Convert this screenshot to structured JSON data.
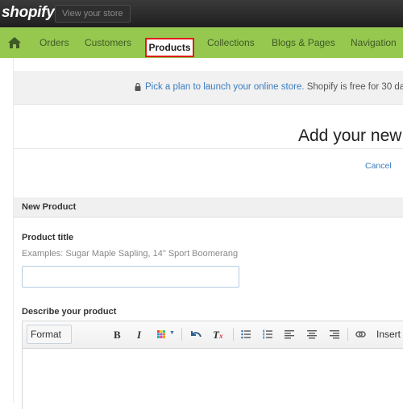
{
  "topbar": {
    "logo": "shopify",
    "view_store_label": "View your store"
  },
  "nav": {
    "items": [
      {
        "label": "Orders"
      },
      {
        "label": "Customers"
      },
      {
        "label": "Products",
        "active": true
      },
      {
        "label": "Collections"
      },
      {
        "label": "Blogs & Pages"
      },
      {
        "label": "Navigation"
      }
    ]
  },
  "banner": {
    "link_text": "Pick a plan to launch your online store.",
    "text": " Shopify is free for 30 da"
  },
  "page": {
    "title": "Add your new",
    "cancel_label": "Cancel"
  },
  "form": {
    "section_title": "New Product",
    "product_title_label": "Product title",
    "product_title_hint": "Examples: Sugar Maple Sapling, 14\" Sport Boomerang",
    "product_title_value": "",
    "describe_label": "Describe your product",
    "toolbar": {
      "format_label": "Format",
      "bold_label": "B",
      "italic_label": "I",
      "insert_label": "Insert"
    }
  },
  "colors": {
    "nav_green": "#96c850",
    "active_outline": "#e11a1a",
    "link_blue": "#3a7bbf"
  }
}
